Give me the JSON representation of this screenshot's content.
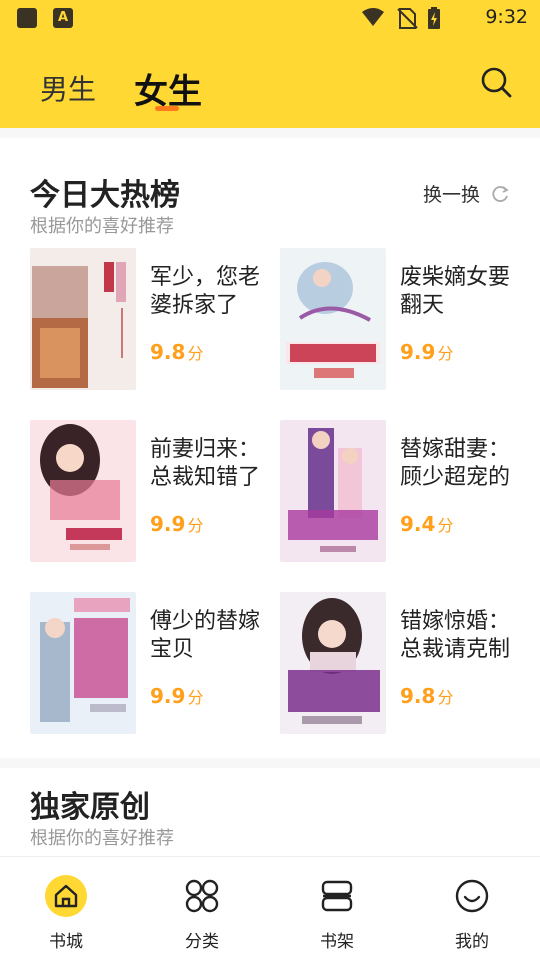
{
  "status_bar": {
    "time": "9:32",
    "app_badge_letter": "A",
    "icons": [
      "app-icon",
      "notification-app-icon",
      "wifi-icon",
      "no-sim-icon",
      "battery-charging-icon"
    ]
  },
  "header": {
    "background": "#ffd833",
    "tabs": [
      {
        "label": "男生",
        "active": false
      },
      {
        "label": "女生",
        "active": true
      }
    ],
    "accent": "#ff7a1a",
    "search_icon": "search-icon"
  },
  "hot_section": {
    "title": "今日大热榜",
    "subtitle": "根据你的喜好推荐",
    "refresh_label": "换一换",
    "books": [
      {
        "title": "军少，您老婆拆家了",
        "score": "9.8",
        "unit": "分"
      },
      {
        "title": "废柴嫡女要翻天",
        "score": "9.9",
        "unit": "分"
      },
      {
        "title": "前妻归来：总裁知错了",
        "score": "9.9",
        "unit": "分"
      },
      {
        "title": "替嫁甜妻：顾少超宠的",
        "score": "9.4",
        "unit": "分"
      },
      {
        "title": "傅少的替嫁宝贝",
        "score": "9.9",
        "unit": "分"
      },
      {
        "title": "错嫁惊婚：总裁请克制",
        "score": "9.8",
        "unit": "分"
      }
    ],
    "score_color": "#ff9f1a"
  },
  "original_section": {
    "title": "独家原创",
    "subtitle": "根据你的喜好推荐"
  },
  "bottom_nav": [
    {
      "label": "书城",
      "icon": "home-icon",
      "active": true
    },
    {
      "label": "分类",
      "icon": "category-icon",
      "active": false
    },
    {
      "label": "书架",
      "icon": "bookshelf-icon",
      "active": false
    },
    {
      "label": "我的",
      "icon": "profile-icon",
      "active": false
    }
  ]
}
